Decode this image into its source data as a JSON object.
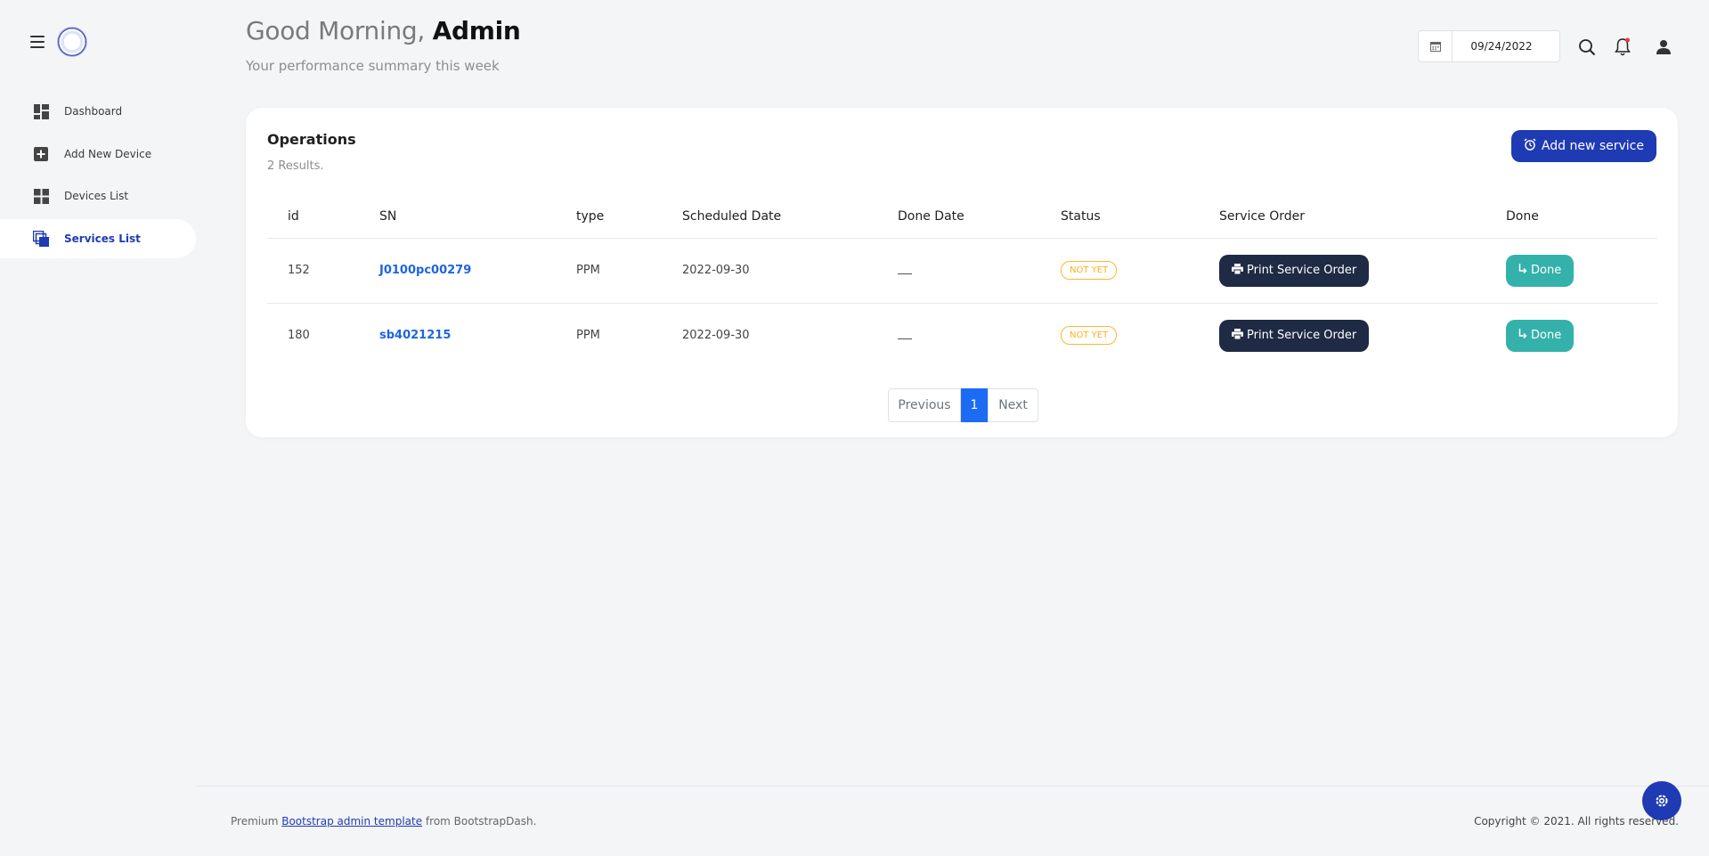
{
  "sidebar": {
    "items": [
      {
        "label": "Dashboard"
      },
      {
        "label": "Add New Device"
      },
      {
        "label": "Devices List"
      },
      {
        "label": "Services List"
      }
    ],
    "active_index": 3
  },
  "header": {
    "greeting": "Good Morning,",
    "user": "Admin",
    "subtitle": "Your performance summary this week",
    "date_value": "09/24/2022"
  },
  "card": {
    "title": "Operations",
    "results": "2 Results.",
    "add_button": "Add new service",
    "columns": [
      "id",
      "SN",
      "type",
      "Scheduled Date",
      "Done Date",
      "Status",
      "Service Order",
      "Done"
    ],
    "rows": [
      {
        "id": "152",
        "sn": "J0100pc00279",
        "type": "PPM",
        "scheduled": "2022-09-30",
        "status": "NOT YET",
        "print": "Print Service Order",
        "done": "Done"
      },
      {
        "id": "180",
        "sn": "sb4021215",
        "type": "PPM",
        "scheduled": "2022-09-30",
        "status": "NOT YET",
        "print": "Print Service Order",
        "done": "Done"
      }
    ]
  },
  "pagination": {
    "previous": "Previous",
    "current": "1",
    "next": "Next"
  },
  "footer": {
    "prefix": "Premium ",
    "link": "Bootstrap admin template",
    "suffix": " from BootstrapDash.",
    "copyright": "Copyright © 2021. All rights reserved."
  },
  "colors": {
    "primary": "#1f3bb3",
    "success": "#34b1aa",
    "warning": "#ffaf1f",
    "dark": "#1f2a44"
  }
}
